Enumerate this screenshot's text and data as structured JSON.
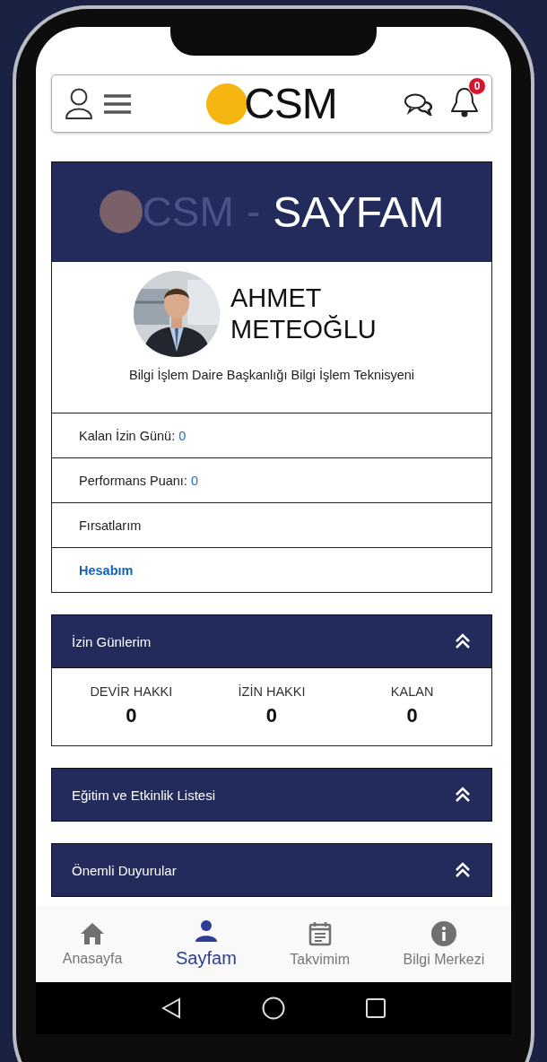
{
  "header": {
    "logo": "CSM",
    "notification_count": "0"
  },
  "banner": {
    "logo": "CSM",
    "separator": "-",
    "title": "SAYFAM"
  },
  "profile": {
    "name": "AHMET METEOĞLU",
    "job_title": "Bilgi İşlem Daire Başkanlığı Bilgi İşlem Teknisyeni"
  },
  "profile_rows": [
    {
      "kind": "stat",
      "label": "Kalan İzin Günü:",
      "value": "0"
    },
    {
      "kind": "stat",
      "label": "Performans Puanı:",
      "value": "0"
    },
    {
      "kind": "plain",
      "label": "Fırsatlarım"
    },
    {
      "kind": "link",
      "label": "Hesabım"
    }
  ],
  "sections": [
    {
      "title": "İzin Günlerim",
      "stats": [
        {
          "label": "DEVİR HAKKI",
          "value": "0"
        },
        {
          "label": "İZİN HAKKI",
          "value": "0"
        },
        {
          "label": "KALAN",
          "value": "0"
        }
      ]
    },
    {
      "title": "Eğitim ve Etkinlik Listesi"
    },
    {
      "title": "Önemli Duyurular"
    }
  ],
  "bottom_nav": [
    {
      "label": "Anasayfa",
      "kind": "home",
      "selected": false
    },
    {
      "label": "Sayfam",
      "kind": "person",
      "selected": true
    },
    {
      "label": "Takvimim",
      "kind": "calendar",
      "selected": false
    },
    {
      "label": "Bilgi Merkezi",
      "kind": "info",
      "selected": false
    }
  ]
}
